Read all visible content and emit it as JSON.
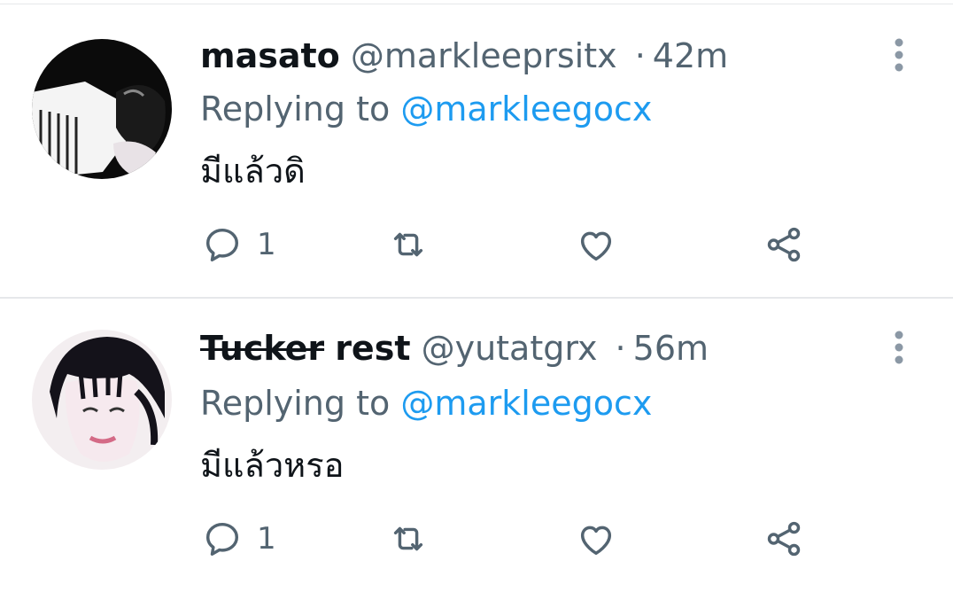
{
  "tweets": [
    {
      "display_name": "masato",
      "display_name_strike": "",
      "handle": "@markleeprsitx",
      "separator": "·",
      "time": "42m",
      "replying_prefix": "Replying to",
      "replying_to": "@markleegocx",
      "text": "มีแล้วดิ",
      "reply_count": "1",
      "icons": [
        "more-vertical-icon",
        "reply-icon",
        "retweet-icon",
        "like-icon",
        "share-icon"
      ]
    },
    {
      "display_name": "rest",
      "display_name_strike": "Tucker",
      "handle": "@yutatgrx",
      "separator": "·",
      "time": "56m",
      "replying_prefix": "Replying to",
      "replying_to": "@markleegocx",
      "text": "มีแล้วหรอ",
      "reply_count": "1",
      "icons": [
        "more-vertical-icon",
        "reply-icon",
        "retweet-icon",
        "like-icon",
        "share-icon"
      ]
    }
  ],
  "colors": {
    "text_primary": "#0f1419",
    "text_secondary": "#536471",
    "link": "#1d9bf0",
    "divider": "#e6e8ea"
  }
}
